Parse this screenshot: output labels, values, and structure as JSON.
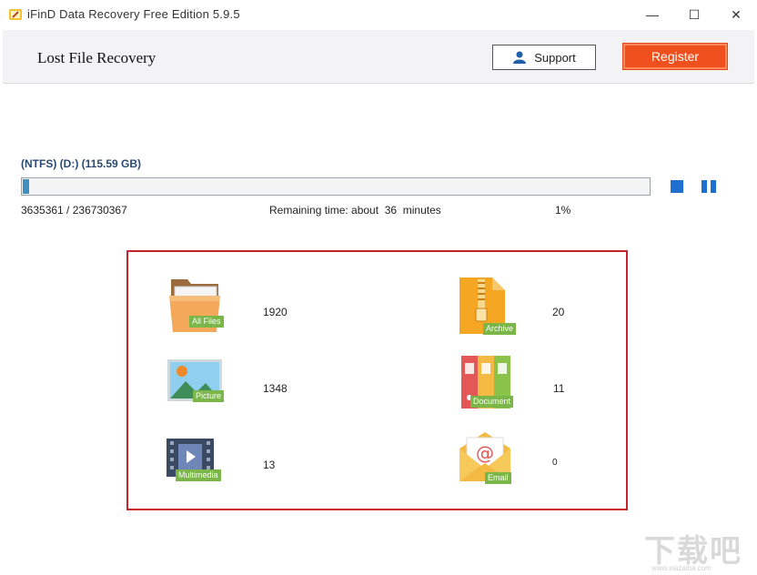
{
  "window": {
    "title": "iFinD Data Recovery Free Edition 5.9.5",
    "minimize": "—",
    "maximize": "☐",
    "close": "✕"
  },
  "header": {
    "title": "Lost File Recovery",
    "support_label": "Support",
    "register_label": "Register",
    "accent_color": "#f0501e"
  },
  "scan": {
    "drive_label": "(NTFS) (D:) (115.59 GB)",
    "progress_fraction": 0.01,
    "count_text": "3635361 / 236730367",
    "remaining_text": "Remaining time: about  36  minutes",
    "percent_text": "1%"
  },
  "categories": [
    {
      "name": "All Files",
      "count": "1920",
      "icon": "folder-icon"
    },
    {
      "name": "Archive",
      "count": "20",
      "icon": "archive-icon"
    },
    {
      "name": "Picture",
      "count": "1348",
      "icon": "picture-icon"
    },
    {
      "name": "Document",
      "count": "11",
      "icon": "document-icon"
    },
    {
      "name": "Multimedia",
      "count": "13",
      "icon": "multimedia-icon"
    },
    {
      "name": "Email",
      "count": "0",
      "icon": "email-icon"
    }
  ],
  "watermark": {
    "text": "下载吧",
    "subtext": "www.xiazaiba.com"
  }
}
